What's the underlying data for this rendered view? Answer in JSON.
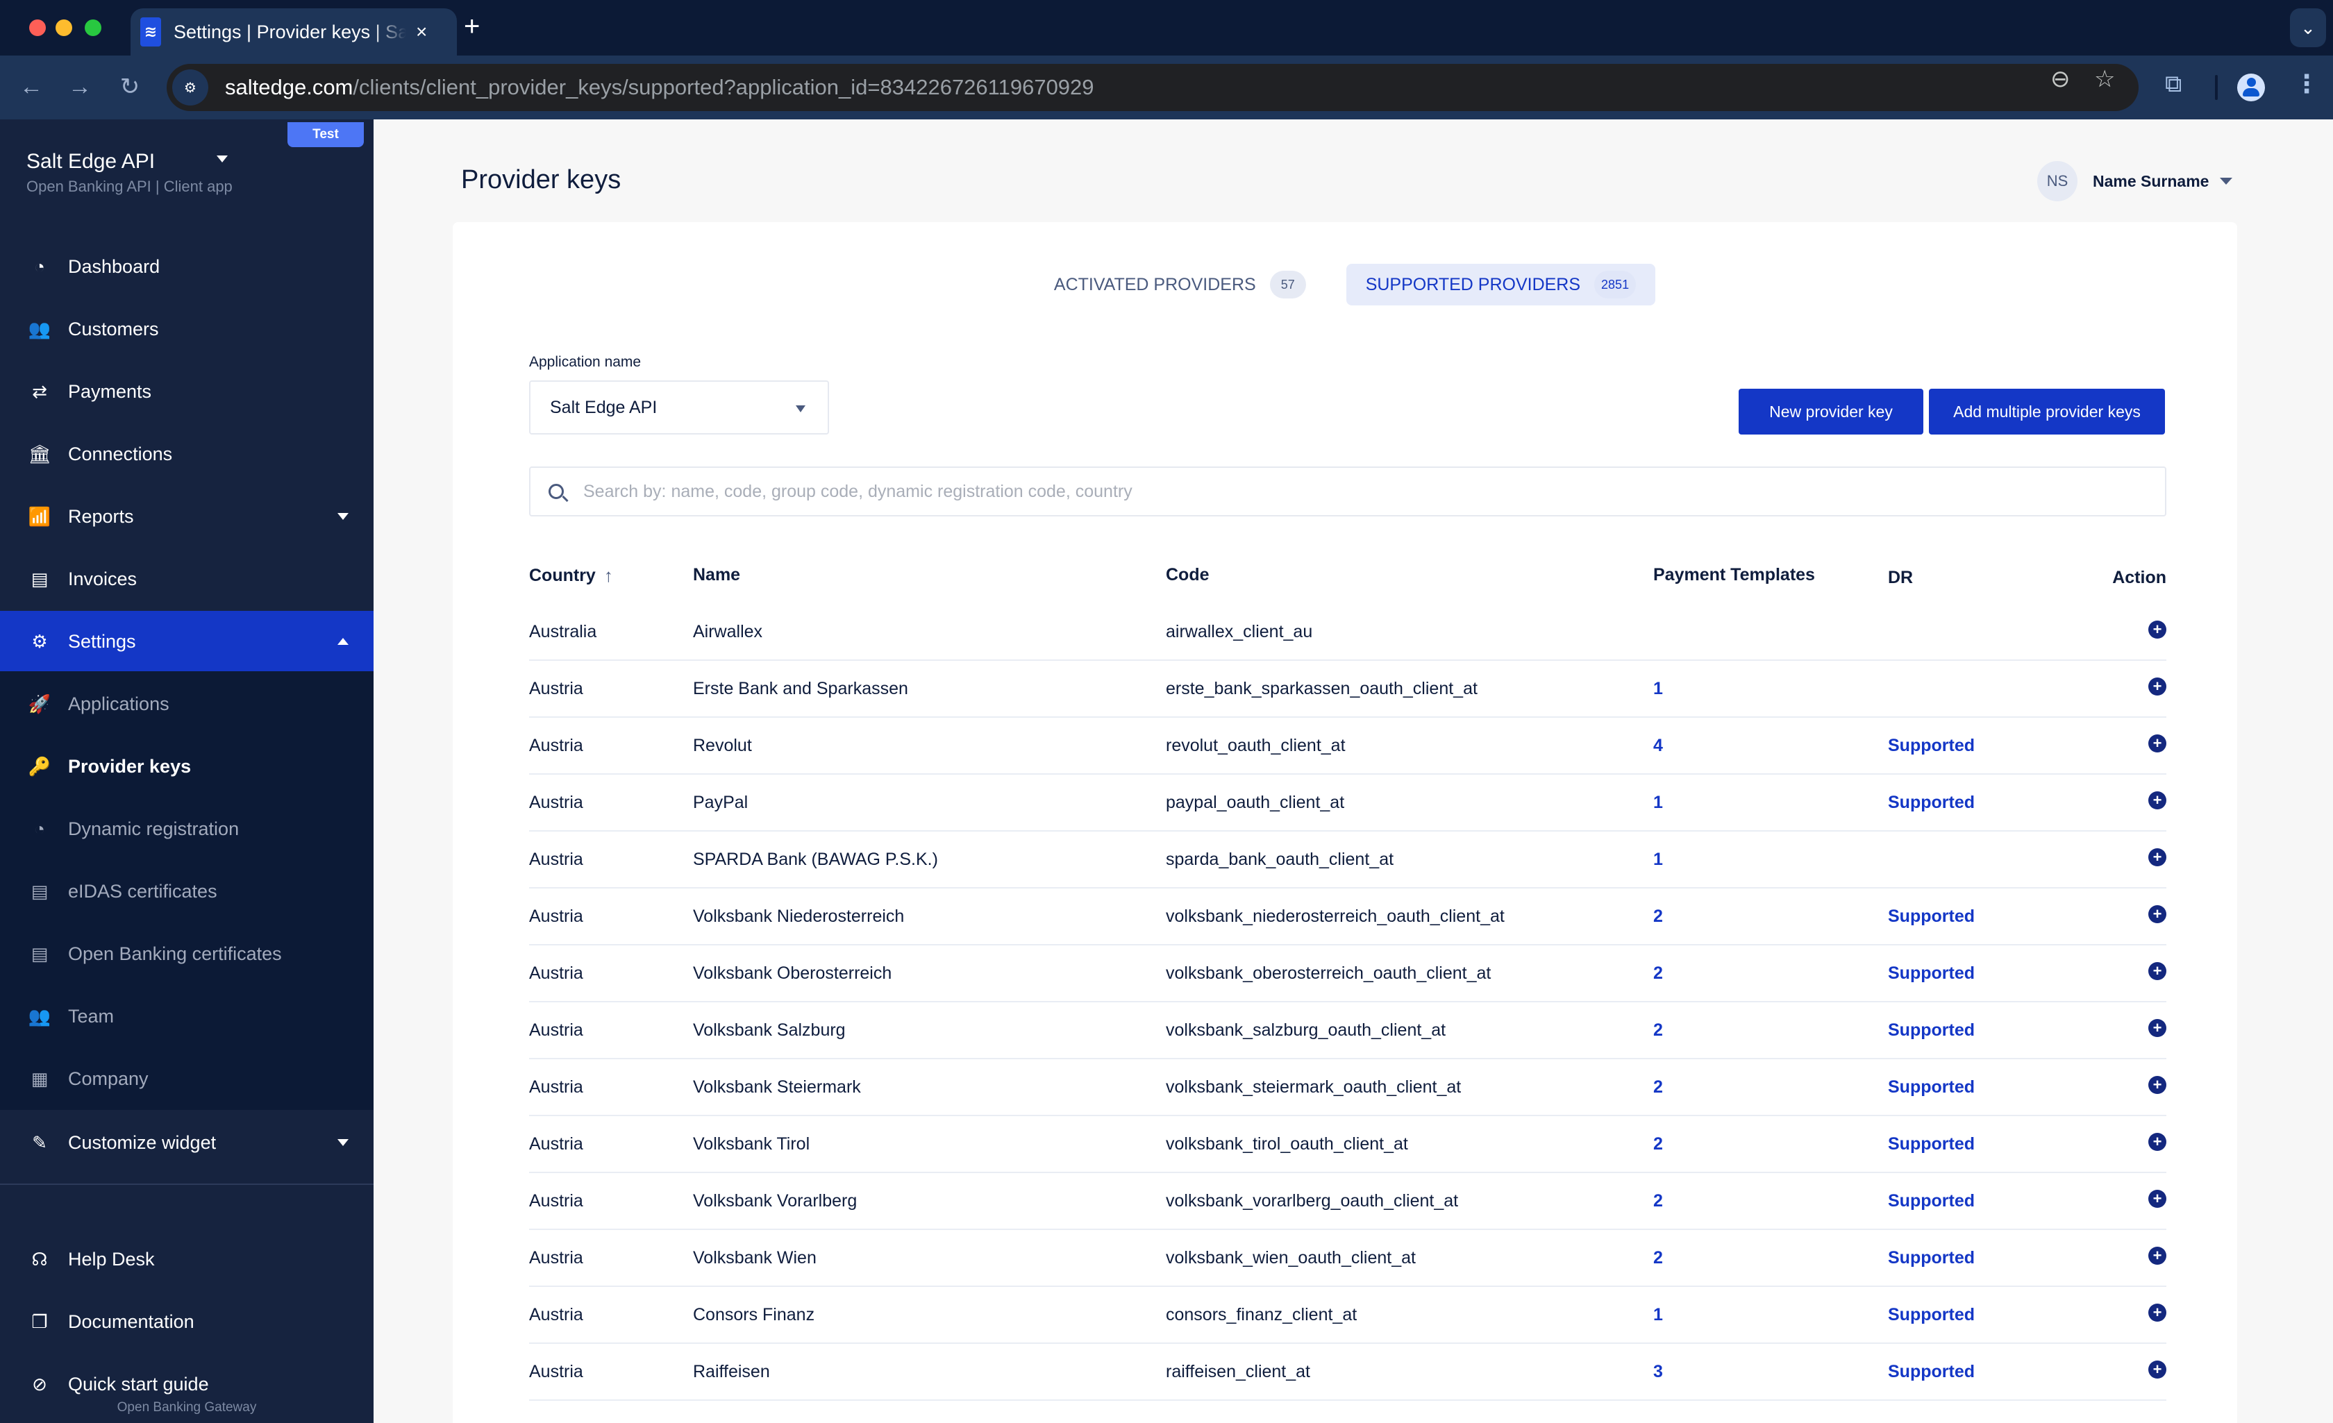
{
  "browser": {
    "tab_title": "Settings | Provider keys | Salt Edge",
    "tab_close_icon": "×",
    "new_tab_icon": "+",
    "tab_menu_icon": "⌄",
    "url_host": "saltedge.com",
    "url_path": "/clients/client_provider_keys/supported?application_id=834226726119670929",
    "back_icon": "←",
    "forward_icon": "→",
    "reload_icon": "↻",
    "zoom_icon": "⊖",
    "bookmark_icon": "☆",
    "extensions_icon": "⧉",
    "menu_icon": "⋮",
    "site_info_icon": "⚙"
  },
  "sidebar": {
    "env_badge": "Test",
    "app_title": "Salt Edge API",
    "app_subtitle": "Open Banking API | Client app",
    "items": [
      {
        "label": "Dashboard",
        "icon": "◔"
      },
      {
        "label": "Customers",
        "icon": "👥"
      },
      {
        "label": "Payments",
        "icon": "⇄"
      },
      {
        "label": "Connections",
        "icon": "🏛"
      },
      {
        "label": "Reports",
        "icon": "📶"
      },
      {
        "label": "Invoices",
        "icon": "▤"
      },
      {
        "label": "Settings",
        "icon": "⚙"
      }
    ],
    "settings_sub": [
      {
        "label": "Applications",
        "icon": "🚀"
      },
      {
        "label": "Provider keys",
        "icon": "🔑"
      },
      {
        "label": "Dynamic registration",
        "icon": "◔"
      },
      {
        "label": "eIDAS certificates",
        "icon": "▤"
      },
      {
        "label": "Open Banking certificates",
        "icon": "▤"
      },
      {
        "label": "Team",
        "icon": "👥"
      },
      {
        "label": "Company",
        "icon": "▦"
      }
    ],
    "customize": {
      "label": "Customize widget",
      "icon": "✎"
    },
    "footer_links": [
      {
        "label": "Help Desk",
        "icon": "☊"
      },
      {
        "label": "Documentation",
        "icon": "❐"
      },
      {
        "label": "Quick start guide",
        "icon": "⊘"
      }
    ],
    "footer_note": "Open Banking Gateway"
  },
  "header": {
    "page_title": "Provider keys",
    "user_initials": "NS",
    "user_name": "Name Surname"
  },
  "tabs": [
    {
      "label": "ACTIVATED PROVIDERS",
      "count": "57",
      "active": false
    },
    {
      "label": "SUPPORTED PROVIDERS",
      "count": "2851",
      "active": true
    }
  ],
  "filters": {
    "application_label": "Application name",
    "application_value": "Salt Edge API",
    "search_placeholder": "Search by: name, code, group code, dynamic registration code, country",
    "search_value": ""
  },
  "actions": {
    "new_key": "New provider key",
    "add_multiple": "Add multiple provider keys"
  },
  "table": {
    "headers": {
      "country": "Country",
      "name": "Name",
      "code": "Code",
      "payment_templates": "Payment Templates",
      "dr": "DR",
      "action": "Action"
    },
    "sort_icon": "↑",
    "add_icon": "+",
    "rows": [
      {
        "country": "Australia",
        "name": "Airwallex",
        "code": "airwallex_client_au",
        "payment_templates": "",
        "dr": ""
      },
      {
        "country": "Austria",
        "name": "Erste Bank and Sparkassen",
        "code": "erste_bank_sparkassen_oauth_client_at",
        "payment_templates": "1",
        "dr": ""
      },
      {
        "country": "Austria",
        "name": "Revolut",
        "code": "revolut_oauth_client_at",
        "payment_templates": "4",
        "dr": "Supported"
      },
      {
        "country": "Austria",
        "name": "PayPal",
        "code": "paypal_oauth_client_at",
        "payment_templates": "1",
        "dr": "Supported"
      },
      {
        "country": "Austria",
        "name": "SPARDA Bank (BAWAG P.S.K.)",
        "code": "sparda_bank_oauth_client_at",
        "payment_templates": "1",
        "dr": ""
      },
      {
        "country": "Austria",
        "name": "Volksbank Niederosterreich",
        "code": "volksbank_niederosterreich_oauth_client_at",
        "payment_templates": "2",
        "dr": "Supported"
      },
      {
        "country": "Austria",
        "name": "Volksbank Oberosterreich",
        "code": "volksbank_oberosterreich_oauth_client_at",
        "payment_templates": "2",
        "dr": "Supported"
      },
      {
        "country": "Austria",
        "name": "Volksbank Salzburg",
        "code": "volksbank_salzburg_oauth_client_at",
        "payment_templates": "2",
        "dr": "Supported"
      },
      {
        "country": "Austria",
        "name": "Volksbank Steiermark",
        "code": "volksbank_steiermark_oauth_client_at",
        "payment_templates": "2",
        "dr": "Supported"
      },
      {
        "country": "Austria",
        "name": "Volksbank Tirol",
        "code": "volksbank_tirol_oauth_client_at",
        "payment_templates": "2",
        "dr": "Supported"
      },
      {
        "country": "Austria",
        "name": "Volksbank Vorarlberg",
        "code": "volksbank_vorarlberg_oauth_client_at",
        "payment_templates": "2",
        "dr": "Supported"
      },
      {
        "country": "Austria",
        "name": "Volksbank Wien",
        "code": "volksbank_wien_oauth_client_at",
        "payment_templates": "2",
        "dr": "Supported"
      },
      {
        "country": "Austria",
        "name": "Consors Finanz",
        "code": "consors_finanz_client_at",
        "payment_templates": "1",
        "dr": "Supported"
      },
      {
        "country": "Austria",
        "name": "Raiffeisen",
        "code": "raiffeisen_client_at",
        "payment_templates": "3",
        "dr": "Supported"
      }
    ]
  },
  "colors": {
    "sidebar_bg": "#16233f",
    "sidebar_sub_bg": "#0c1a36",
    "accent": "#1437c6",
    "badge": "#4d76f5",
    "page_bg": "#f7f7f7",
    "action_icon": "#14287f"
  }
}
